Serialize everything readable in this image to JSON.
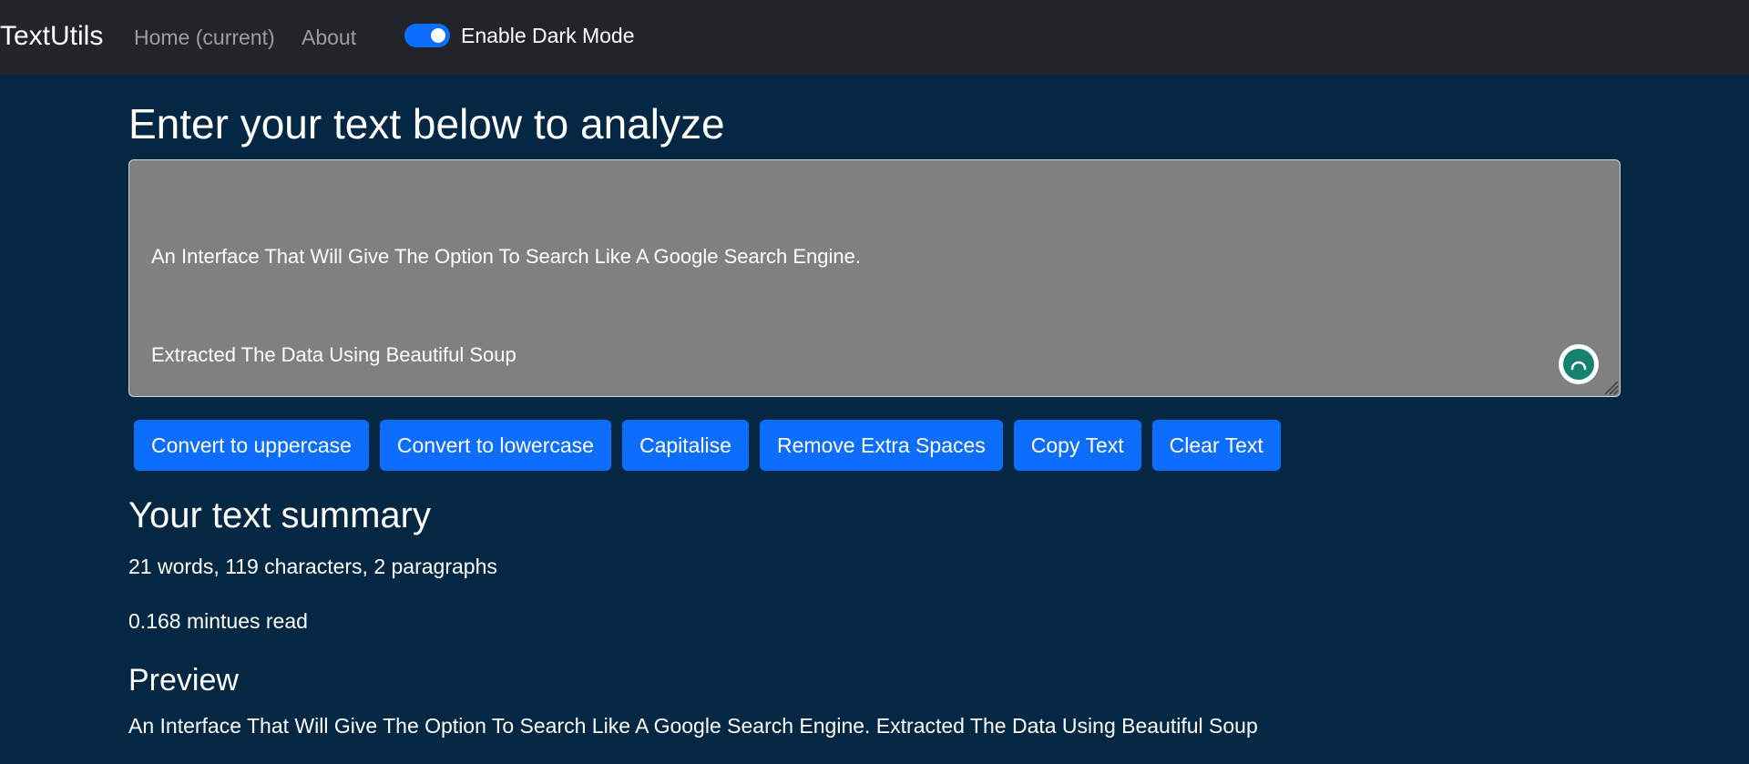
{
  "navbar": {
    "brand": "TextUtils",
    "links": [
      "Home (current)",
      "About"
    ],
    "dark_mode_toggle": {
      "label": "Enable Dark Mode",
      "checked": true
    }
  },
  "main": {
    "heading": "Enter your text below to analyze",
    "textarea": {
      "lines": [
        "An Interface That Will Give The Option To Search Like A Google Search Engine.",
        "Extracted The Data Using Beautiful Soup"
      ]
    },
    "buttons": [
      "Convert to uppercase",
      "Convert to lowercase",
      "Capitalise",
      "Remove Extra Spaces",
      "Copy Text",
      "Clear Text"
    ]
  },
  "summary": {
    "title": "Your text summary",
    "stats": "21 words, 119 characters, 2 paragraphs",
    "read_time": "0.168 mintues read"
  },
  "preview": {
    "title": "Preview",
    "text": "An Interface That Will Give The Option To Search Like A Google Search Engine. Extracted The Data Using Beautiful Soup"
  },
  "colors": {
    "navbar_bg": "#212529",
    "page_bg": "#042743",
    "textarea_bg": "#808080",
    "button_bg": "#0d6efd",
    "grammarly": "#15826d"
  },
  "icons": {
    "grammarly": "grammarly-icon",
    "resize": "resize-handle-icon"
  }
}
